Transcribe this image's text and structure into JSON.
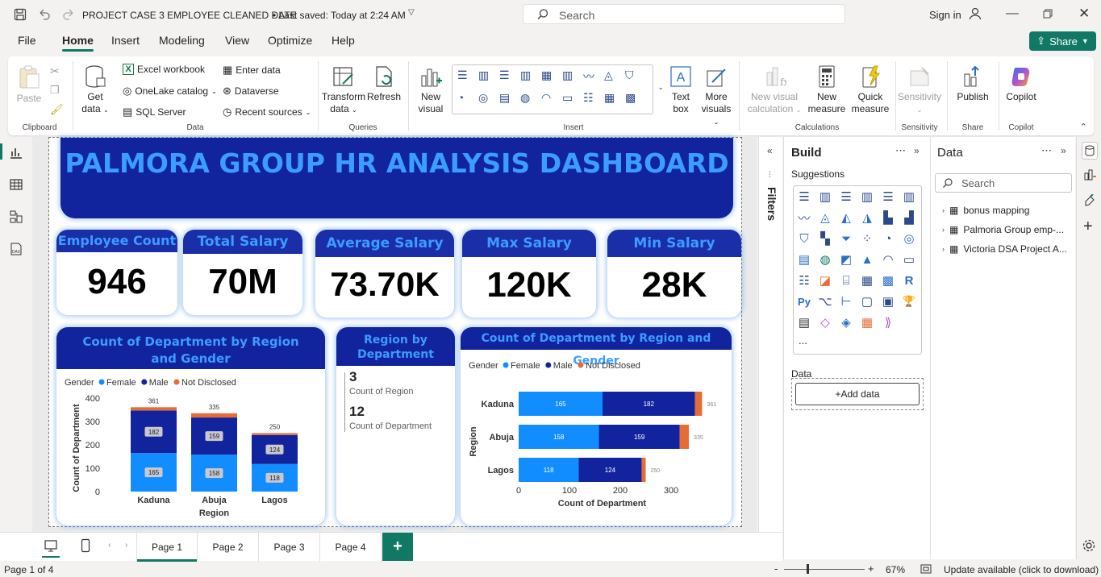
{
  "titlebar": {
    "doc_title": "PROJECT CASE 3 EMPLOYEE CLEANED DATE",
    "saved": "• Last saved: Today at 2:24 AM",
    "search_placeholder": "Search",
    "sign_in": "Sign in"
  },
  "menu": {
    "file": "File",
    "home": "Home",
    "insert": "Insert",
    "modeling": "Modeling",
    "view": "View",
    "optimize": "Optimize",
    "help": "Help",
    "share": "Share"
  },
  "ribbon": {
    "clipboard": {
      "label": "Clipboard",
      "paste": "Paste"
    },
    "data": {
      "label": "Data",
      "get_data_1": "Get",
      "get_data_2": "data",
      "excel": "Excel workbook",
      "onelake": "OneLake catalog",
      "sql": "SQL Server",
      "enter_data": "Enter data",
      "dataverse": "Dataverse",
      "recent": "Recent sources"
    },
    "queries": {
      "label": "Queries",
      "transform_1": "Transform",
      "transform_2": "data",
      "refresh": "Refresh"
    },
    "insert": {
      "label": "Insert",
      "new_visual_1": "New",
      "new_visual_2": "visual",
      "text_box_1": "Text",
      "text_box_2": "box",
      "more_visuals_1": "More",
      "more_visuals_2": "visuals"
    },
    "calculations": {
      "label": "Calculations",
      "new_visual_calc_1": "New visual",
      "new_visual_calc_2": "calculation",
      "new_measure_1": "New",
      "new_measure_2": "measure",
      "quick_measure_1": "Quick",
      "quick_measure_2": "measure"
    },
    "sensitivity": {
      "label": "Sensitivity",
      "btn": "Sensitivity"
    },
    "share": {
      "label": "Share",
      "publish": "Publish"
    },
    "copilot": {
      "label": "Copilot",
      "btn": "Copilot"
    }
  },
  "report": {
    "title": "PALMORA GROUP HR ANALYSIS DASHBOARD",
    "cards": [
      {
        "label": "Employee Count",
        "value": "946"
      },
      {
        "label": "Total Salary",
        "value": "70M"
      },
      {
        "label": "Average Salary",
        "value": "73.70K"
      },
      {
        "label": "Max Salary",
        "value": "120K"
      },
      {
        "label": "Min Salary",
        "value": "28K"
      }
    ],
    "region_card": {
      "title": "Region by Department",
      "v1": "3",
      "l1": "Count of Region",
      "v2": "12",
      "l2": "Count of Department"
    }
  },
  "chart_data": [
    {
      "type": "bar",
      "orientation": "vertical-stacked",
      "title": "Count of Department by Region and Gender",
      "legend_title": "Gender",
      "legend_placement": "top-left",
      "xlabel": "Region",
      "ylabel": "Count of Department",
      "categories": [
        "Kaduna",
        "Abuja",
        "Lagos"
      ],
      "series": [
        {
          "name": "Female",
          "values": [
            165,
            158,
            118
          ]
        },
        {
          "name": "Male",
          "values": [
            182,
            159,
            124
          ]
        },
        {
          "name": "Not Disclosed",
          "values": [
            14,
            18,
            8
          ]
        }
      ],
      "totals": [
        361,
        335,
        250
      ],
      "yticks": [
        "0",
        "100",
        "200",
        "300",
        "400"
      ],
      "ylim": [
        0,
        400
      ],
      "colors": {
        "Female": "#118dff",
        "Male": "#12239e",
        "Not Disclosed": "#e66c37"
      }
    },
    {
      "type": "bar",
      "orientation": "horizontal-stacked",
      "title": "Count of Department by Region and Gender",
      "legend_title": "Gender",
      "legend_placement": "top-left",
      "xlabel": "Count of Department",
      "ylabel": "Region",
      "categories": [
        "Kaduna",
        "Abuja",
        "Lagos"
      ],
      "series": [
        {
          "name": "Female",
          "values": [
            165,
            158,
            118
          ]
        },
        {
          "name": "Male",
          "values": [
            182,
            159,
            124
          ]
        },
        {
          "name": "Not Disclosed",
          "values": [
            14,
            18,
            8
          ]
        }
      ],
      "totals": [
        361,
        335,
        250
      ],
      "xticks": [
        "0",
        "100",
        "200",
        "300"
      ],
      "xlim": [
        0,
        360
      ],
      "colors": {
        "Female": "#118dff",
        "Male": "#12239e",
        "Not Disclosed": "#e66c37"
      }
    }
  ],
  "filters": {
    "label": "Filters"
  },
  "build": {
    "title": "Build",
    "suggestions": "Suggestions",
    "more": "...",
    "data_label": "Data",
    "add_data": "+Add data"
  },
  "data_pane": {
    "title": "Data",
    "search_placeholder": "Search",
    "tables": [
      "bonus mapping",
      "Palmoria Group emp-...",
      "Victoria DSA Project A..."
    ]
  },
  "pages": {
    "tabs": [
      "Page 1",
      "Page 2",
      "Page 3",
      "Page 4"
    ],
    "add": "+"
  },
  "status": {
    "page": "Page 1 of 4",
    "zoom": "67%",
    "update": "Update available (click to download)"
  },
  "accent": "#117865"
}
